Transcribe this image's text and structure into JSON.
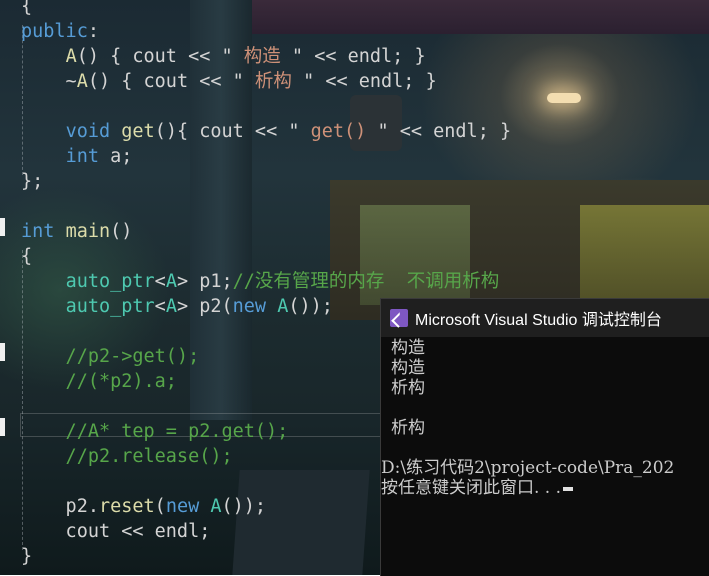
{
  "editor": {
    "lines": [
      [
        {
          "t": "{",
          "c": "tx"
        }
      ],
      [
        {
          "t": "public",
          "c": "kw"
        },
        {
          "t": ":",
          "c": "tx"
        }
      ],
      [
        {
          "t": "    ",
          "c": "tx"
        },
        {
          "t": "A",
          "c": "fn"
        },
        {
          "t": "() { cout << \"",
          "c": "tx"
        },
        {
          "t": " 构造 ",
          "c": "str"
        },
        {
          "t": "\" << endl; }",
          "c": "tx"
        }
      ],
      [
        {
          "t": "    ~",
          "c": "tx"
        },
        {
          "t": "A",
          "c": "fn"
        },
        {
          "t": "() { cout << \"",
          "c": "tx"
        },
        {
          "t": " 析构 ",
          "c": "str"
        },
        {
          "t": "\" << endl; }",
          "c": "tx"
        }
      ],
      [],
      [
        {
          "t": "    ",
          "c": "tx"
        },
        {
          "t": "void",
          "c": "kw"
        },
        {
          "t": " ",
          "c": "tx"
        },
        {
          "t": "get",
          "c": "fn"
        },
        {
          "t": "(){ cout << \"",
          "c": "tx"
        },
        {
          "t": " get() ",
          "c": "str"
        },
        {
          "t": "\" << endl; }",
          "c": "tx"
        }
      ],
      [
        {
          "t": "    ",
          "c": "tx"
        },
        {
          "t": "int",
          "c": "kw"
        },
        {
          "t": " a;",
          "c": "tx"
        }
      ],
      [
        {
          "t": "};",
          "c": "tx"
        }
      ],
      [],
      [
        {
          "t": "int",
          "c": "kw"
        },
        {
          "t": " ",
          "c": "tx"
        },
        {
          "t": "main",
          "c": "fn"
        },
        {
          "t": "()",
          "c": "tx"
        }
      ],
      [
        {
          "t": "{",
          "c": "tx"
        }
      ],
      [
        {
          "t": "    ",
          "c": "tx"
        },
        {
          "t": "auto_ptr",
          "c": "cls"
        },
        {
          "t": "<",
          "c": "tx"
        },
        {
          "t": "A",
          "c": "cls"
        },
        {
          "t": "> p1;",
          "c": "tx"
        },
        {
          "t": "//没有管理的内存  不调用析构",
          "c": "cm"
        }
      ],
      [
        {
          "t": "    ",
          "c": "tx"
        },
        {
          "t": "auto_ptr",
          "c": "cls"
        },
        {
          "t": "<",
          "c": "tx"
        },
        {
          "t": "A",
          "c": "cls"
        },
        {
          "t": "> p2(",
          "c": "tx"
        },
        {
          "t": "new",
          "c": "kw"
        },
        {
          "t": " ",
          "c": "tx"
        },
        {
          "t": "A",
          "c": "cls"
        },
        {
          "t": "());",
          "c": "tx"
        }
      ],
      [],
      [
        {
          "t": "    //p2->get();",
          "c": "cm"
        }
      ],
      [
        {
          "t": "    //(*p2).a;",
          "c": "cm"
        }
      ],
      [],
      [
        {
          "t": "    //A* tep = p2.get();",
          "c": "cm"
        }
      ],
      [
        {
          "t": "    //p2.release();",
          "c": "cm"
        }
      ],
      [],
      [
        {
          "t": "    p2.",
          "c": "tx"
        },
        {
          "t": "reset",
          "c": "fn"
        },
        {
          "t": "(",
          "c": "tx"
        },
        {
          "t": "new",
          "c": "kw"
        },
        {
          "t": " ",
          "c": "tx"
        },
        {
          "t": "A",
          "c": "cls"
        },
        {
          "t": "());",
          "c": "tx"
        }
      ],
      [
        {
          "t": "    cout << endl;",
          "c": "tx"
        }
      ],
      [
        {
          "t": "}",
          "c": "tx"
        }
      ]
    ]
  },
  "console": {
    "title": "Microsoft Visual Studio 调试控制台",
    "output": [
      {
        "text": "构造",
        "flush": false
      },
      {
        "text": "构造",
        "flush": false
      },
      {
        "text": "析构",
        "flush": false
      },
      {
        "text": "",
        "flush": false
      },
      {
        "text": "析构",
        "flush": false
      },
      {
        "text": "",
        "flush": false
      },
      {
        "text": "D:\\练习代码2\\project-code\\Pra_202",
        "flush": true
      },
      {
        "text": "按任意键关闭此窗口. . .",
        "flush": true
      }
    ]
  }
}
